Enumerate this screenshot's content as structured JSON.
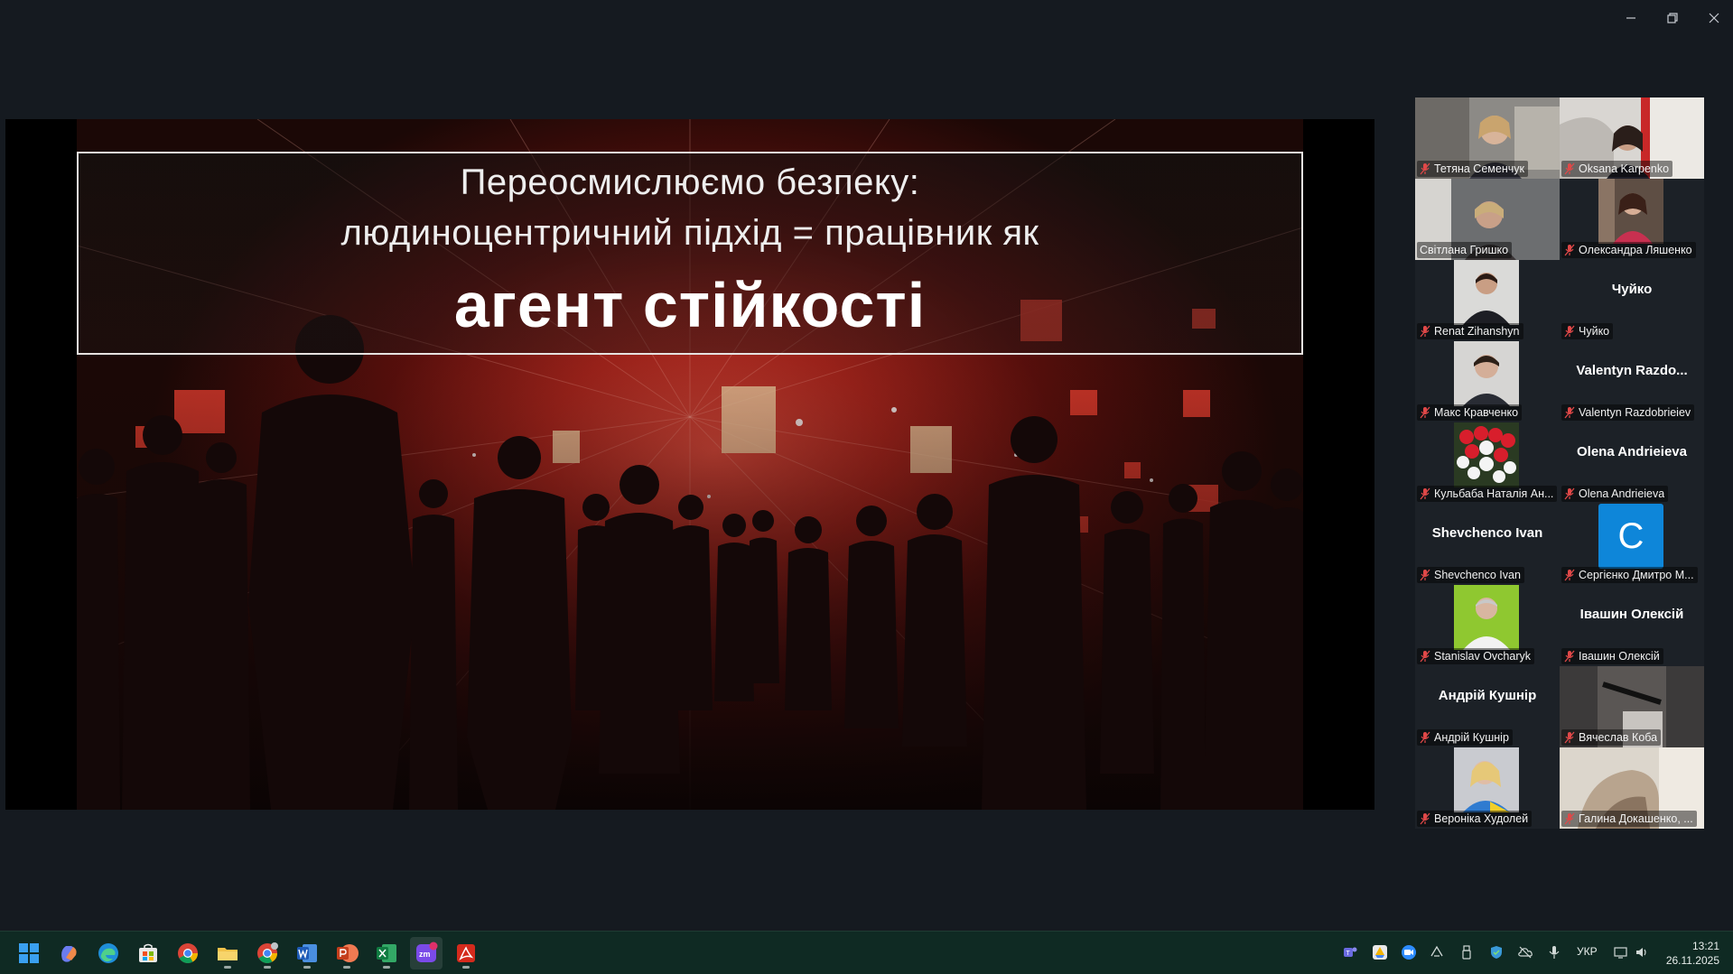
{
  "window": {
    "controls": [
      "minimize",
      "restore",
      "close"
    ]
  },
  "slide": {
    "title_line1": "Переосмислюємо безпеку:",
    "title_line2": "людиноцентричний підхід = працівник як",
    "title_line3": "агент стійкості",
    "accent": "#d8302a"
  },
  "participants": [
    {
      "name": "Тетяна Семенчук",
      "muted": true,
      "video": true
    },
    {
      "name": "Oksana Karpenko",
      "muted": true,
      "video": true
    },
    {
      "name": "Світлана Гришко",
      "muted": false,
      "video": true,
      "active_speaker": true
    },
    {
      "name": "Олександра Ляшенко",
      "muted": true,
      "video": true
    },
    {
      "name": "Renat Zihanshyn",
      "muted": true,
      "video": true
    },
    {
      "name": "Чуйко",
      "display": "Чуйко",
      "muted": true,
      "video": false
    },
    {
      "name": "Макс Кравченко",
      "muted": true,
      "video": true
    },
    {
      "name": "Valentyn Razdobrieiev",
      "display": "Valentyn  Razdo...",
      "muted": true,
      "video": false
    },
    {
      "name": "Кульбаба Наталія Ан...",
      "muted": true,
      "video": true
    },
    {
      "name": "Olena Andrieieva",
      "display": "Olena Andrieieva",
      "muted": true,
      "video": false
    },
    {
      "name": "Shevchenco Ivan",
      "display": "Shevchenco Ivan",
      "muted": true,
      "video": false
    },
    {
      "name": "Сергієнко Дмитро М...",
      "avatar_letter": "C",
      "muted": true,
      "video": false
    },
    {
      "name": "Stanislav Ovcharyk",
      "muted": true,
      "video": true
    },
    {
      "name": "Івашин Олексій",
      "display": "Івашин Олексій",
      "muted": true,
      "video": false
    },
    {
      "name": "Андрій Кушнір",
      "display": "Андрій Кушнір",
      "muted": true,
      "video": false
    },
    {
      "name": "Вячеслав Коба",
      "muted": true,
      "video": true
    },
    {
      "name": "Вероніка Худолей",
      "muted": true,
      "video": true
    },
    {
      "name": "Галина Докашенко, ...",
      "muted": true,
      "video": true
    }
  ],
  "taskbar": {
    "apps": [
      "start-icon",
      "copilot-icon",
      "edge-icon",
      "store-icon",
      "chrome-icon",
      "file-explorer-icon",
      "chrome-profile-icon",
      "word-icon",
      "powerpoint-icon",
      "excel-icon",
      "zoom-icon",
      "acrobat-icon"
    ],
    "zoom_badge": "3",
    "language": "УКР",
    "time": "13:21",
    "date": "26.11.2025"
  },
  "colors": {
    "active_speaker_border": "#27d27a",
    "muted_icon": "#e04848",
    "taskbar_bg": "#0f2a23"
  }
}
